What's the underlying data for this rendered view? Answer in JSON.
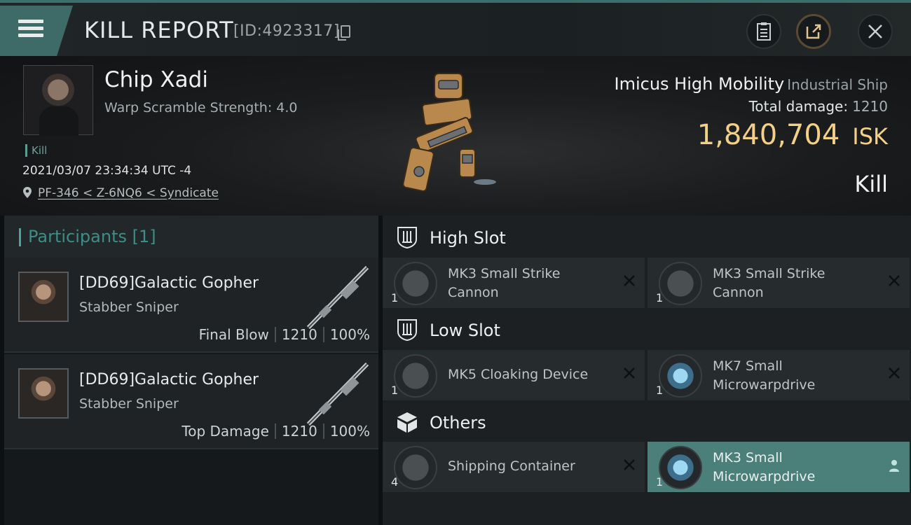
{
  "header": {
    "title": "KILL REPORT",
    "report_id": "[ID:4923317]",
    "icons": [
      "menu-icon",
      "copy-icon",
      "clipboard-icon",
      "share-icon",
      "close-icon"
    ]
  },
  "victim": {
    "name": "Chip Xadi",
    "warp_scramble": "Warp Scramble Strength: 4.0",
    "tag": "Kill",
    "timestamp": "2021/03/07 23:34:34 UTC -4",
    "location": "PF-346 < Z-6NQ6 < Syndicate"
  },
  "ship": {
    "name": "Imicus High Mobility",
    "class": "Industrial Ship",
    "total_damage_label": "Total damage:",
    "total_damage": "1210",
    "isk_value": "1,840,704",
    "isk_unit": "ISK",
    "result": "Kill"
  },
  "participants": {
    "title": "Participants [1]",
    "rows": [
      {
        "name": "[DD69]Galactic Gopher",
        "ship": "Stabber Sniper",
        "role": "Final Blow",
        "damage": "1210",
        "percent": "100%"
      },
      {
        "name": "[DD69]Galactic Gopher",
        "ship": "Stabber Sniper",
        "role": "Top Damage",
        "damage": "1210",
        "percent": "100%"
      }
    ]
  },
  "fitting": {
    "high": {
      "label": "High Slot",
      "modules": [
        {
          "name": "MK3 Small Strike Cannon",
          "qty": "1"
        },
        {
          "name": "MK3 Small Strike Cannon",
          "qty": "1"
        }
      ]
    },
    "low": {
      "label": "Low Slot",
      "modules": [
        {
          "name": "MK5 Cloaking Device",
          "qty": "1"
        },
        {
          "name": "MK7 Small Microwarpdrive",
          "qty": "1"
        }
      ]
    },
    "others": {
      "label": "Others",
      "modules": [
        {
          "name": "Shipping Container",
          "qty": "4"
        },
        {
          "name": "MK3 Small Microwarpdrive",
          "qty": "1"
        }
      ]
    }
  },
  "colors": {
    "accent": "#3e6b67",
    "isk": "#f3cf88",
    "highlight": "#4a7f7a"
  }
}
